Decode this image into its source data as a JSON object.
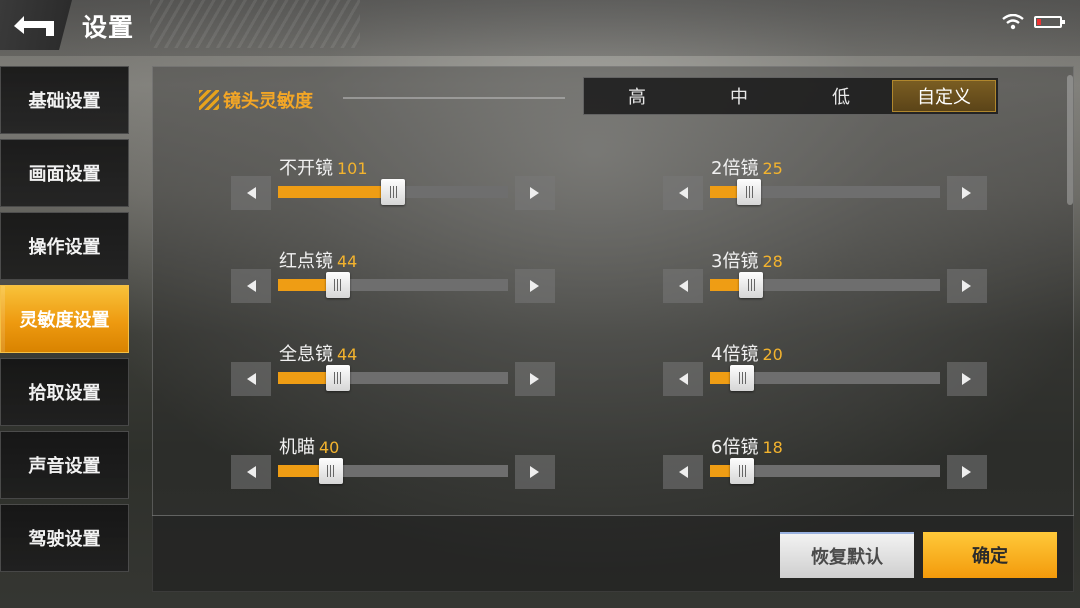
{
  "header": {
    "title": "设置"
  },
  "status_icons": {
    "wifi": "wifi-icon",
    "battery": "battery-icon"
  },
  "sidebar": {
    "items": [
      {
        "label": "基础设置",
        "active": false
      },
      {
        "label": "画面设置",
        "active": false
      },
      {
        "label": "操作设置",
        "active": false
      },
      {
        "label": "灵敏度设置",
        "active": true
      },
      {
        "label": "拾取设置",
        "active": false
      },
      {
        "label": "声音设置",
        "active": false
      },
      {
        "label": "驾驶设置",
        "active": false
      }
    ]
  },
  "section": {
    "title": "镜头灵敏度",
    "presets": [
      "高",
      "中",
      "低",
      "自定义"
    ],
    "selected_preset": "自定义"
  },
  "sliders_left": [
    {
      "name": "不开镜",
      "value": "101",
      "fill": 0.5
    },
    {
      "name": "红点镜",
      "value": "44",
      "fill": 0.26
    },
    {
      "name": "全息镜",
      "value": "44",
      "fill": 0.26
    },
    {
      "name": "机瞄",
      "value": "40",
      "fill": 0.23
    }
  ],
  "sliders_right": [
    {
      "name": "2倍镜",
      "value": "25",
      "fill": 0.17
    },
    {
      "name": "3倍镜",
      "value": "28",
      "fill": 0.18
    },
    {
      "name": "4倍镜",
      "value": "20",
      "fill": 0.14
    },
    {
      "name": "6倍镜",
      "value": "18",
      "fill": 0.14
    }
  ],
  "footer": {
    "reset_label": "恢复默认",
    "confirm_label": "确定"
  },
  "colors": {
    "accent": "#ef9d14",
    "active_tab": "#f0a020",
    "track": "#6e6e6e"
  }
}
